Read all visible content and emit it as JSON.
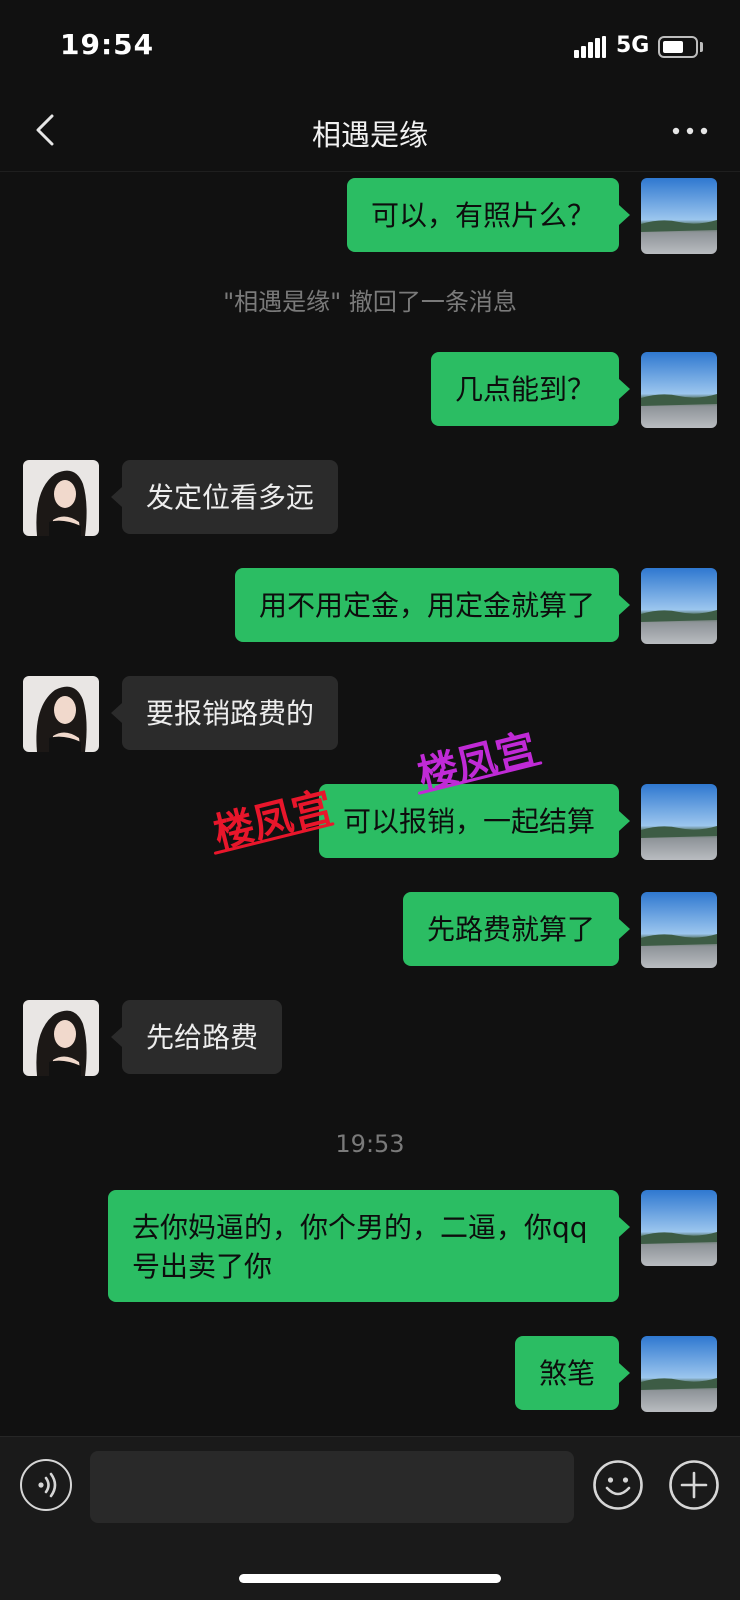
{
  "status_bar": {
    "time": "19:54",
    "network": "5G",
    "battery_level": 0.6
  },
  "header": {
    "title": "相遇是缘"
  },
  "messages": [
    {
      "side": "me",
      "text": "可以，有照片么？"
    },
    {
      "system": "\"相遇是缘\" 撤回了一条消息"
    },
    {
      "side": "me",
      "text": "几点能到？"
    },
    {
      "side": "them",
      "text": "发定位看多远"
    },
    {
      "side": "me",
      "text": "用不用定金，用定金就算了"
    },
    {
      "side": "them",
      "text": "要报销路费的"
    },
    {
      "side": "me",
      "text": "可以报销，一起结算"
    },
    {
      "side": "me",
      "text": "先路费就算了"
    },
    {
      "side": "them",
      "text": "先给路费"
    },
    {
      "timestamp": "19:53"
    },
    {
      "side": "me",
      "text": "去你妈逼的，你个男的，二逼，你qq 号出卖了你"
    },
    {
      "side": "me",
      "text": "煞笔"
    }
  ],
  "watermarks": [
    {
      "text": "楼凤宫",
      "color": "#e8162b"
    },
    {
      "text": "楼凤宫",
      "color": "#c02ad6"
    }
  ],
  "input": {
    "placeholder": "",
    "value": ""
  },
  "colors": {
    "bubble_me": "#2bbd63",
    "bubble_them": "#2b2b2b",
    "background": "#111111"
  }
}
